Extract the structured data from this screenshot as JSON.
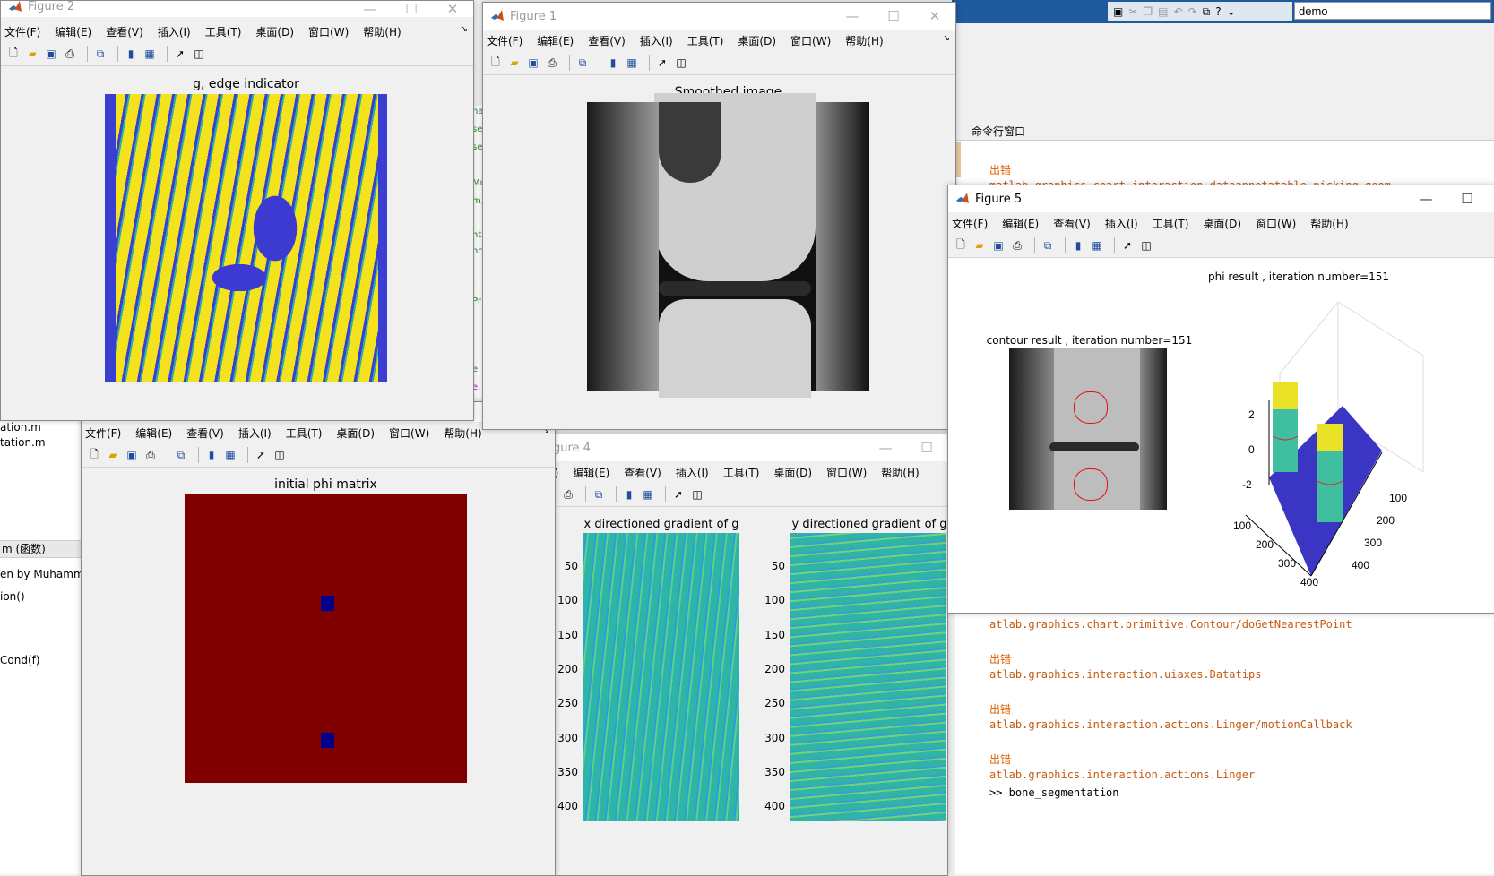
{
  "menus": [
    "文件(F)",
    "编辑(E)",
    "查看(V)",
    "插入(I)",
    "工具(T)",
    "桌面(D)",
    "窗口(W)",
    "帮助(H)"
  ],
  "windows": {
    "fig2": {
      "title": "Figure 2",
      "plot_title": "g,  edge indicator"
    },
    "fig1": {
      "title": "Figure 1",
      "plot_title": "Smoothed image"
    },
    "fig3": {
      "plot_title": "initial phi matrix"
    },
    "fig4": {
      "title": "gure 4",
      "plot1_title": "x directioned gradient of g",
      "plot2_title": "y directioned gradient of g",
      "yticks": [
        "50",
        "100",
        "150",
        "200",
        "250",
        "300",
        "350",
        "400"
      ]
    },
    "fig5": {
      "title": "Figure 5",
      "contour_title": "contour result , iteration number=151",
      "surf_title": "phi result , iteration number=151",
      "z_ticks": [
        "2",
        "0",
        "-2"
      ],
      "x_ticks": [
        "100",
        "200",
        "300",
        "400"
      ],
      "y_ticks": [
        "100",
        "200",
        "300",
        "400"
      ]
    }
  },
  "matlab": {
    "search_value": "demo",
    "command_window_label": "命令行窗口",
    "file_browser": [
      "ation.m",
      "tation.m"
    ],
    "workspace_header": "m  (函数)",
    "workspace_lines": [
      "en by Muhammet",
      "ion()",
      "Cond(f)"
    ],
    "editor_fragments": [
      "na",
      "se",
      "se",
      "Mu",
      "m,",
      "nt",
      "nc",
      ",",
      "Pr",
      "e",
      "e."
    ],
    "console": [
      {
        "kind": "err",
        "text": "出错"
      },
      {
        "kind": "link",
        "text": "matlab.graphics.chart.interaction.dataannotatable.picking.geom"
      },
      {
        "kind": "link",
        "text": "atlab.graphics.chart.primitive.Contour/doGetNearestPoint"
      },
      {
        "kind": "err",
        "text": "出错"
      },
      {
        "kind": "link",
        "text": "atlab.graphics.interaction.uiaxes.Datatips"
      },
      {
        "kind": "err",
        "text": "出错"
      },
      {
        "kind": "link",
        "text": "atlab.graphics.interaction.actions.Linger/motionCallback"
      },
      {
        "kind": "err",
        "text": "出错"
      },
      {
        "kind": "link",
        "text": "atlab.graphics.interaction.actions.Linger"
      },
      {
        "kind": "cmd",
        "text": ">> bone_segmentation"
      }
    ]
  },
  "colors": {
    "phi_red": "#800000",
    "phi_blue": "#00008f",
    "parula_blue": "#3a3ad0",
    "parula_yellow": "#f5e51b"
  }
}
